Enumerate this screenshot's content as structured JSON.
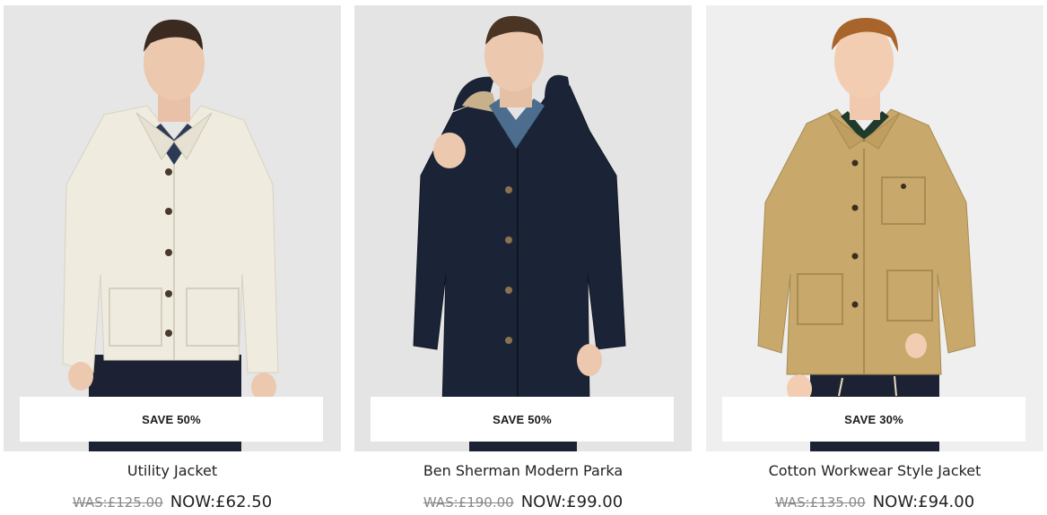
{
  "products": [
    {
      "badge": "SAVE 50%",
      "name": "Utility Jacket",
      "was_price": "WAS:£125.00",
      "now_price": "NOW:£62.50",
      "jacket_color": "#efebdf",
      "bg_color": "#e6e6e6"
    },
    {
      "badge": "SAVE 50%",
      "name": "Ben Sherman Modern Parka",
      "was_price": "WAS:£190.00",
      "now_price": "NOW:£99.00",
      "jacket_color": "#1b2436",
      "bg_color": "#e4e4e4"
    },
    {
      "badge": "SAVE 30%",
      "name": "Cotton Workwear Style Jacket",
      "was_price": "WAS:£135.00",
      "now_price": "NOW:£94.00",
      "jacket_color": "#c8a86b",
      "bg_color": "#efefef"
    }
  ]
}
